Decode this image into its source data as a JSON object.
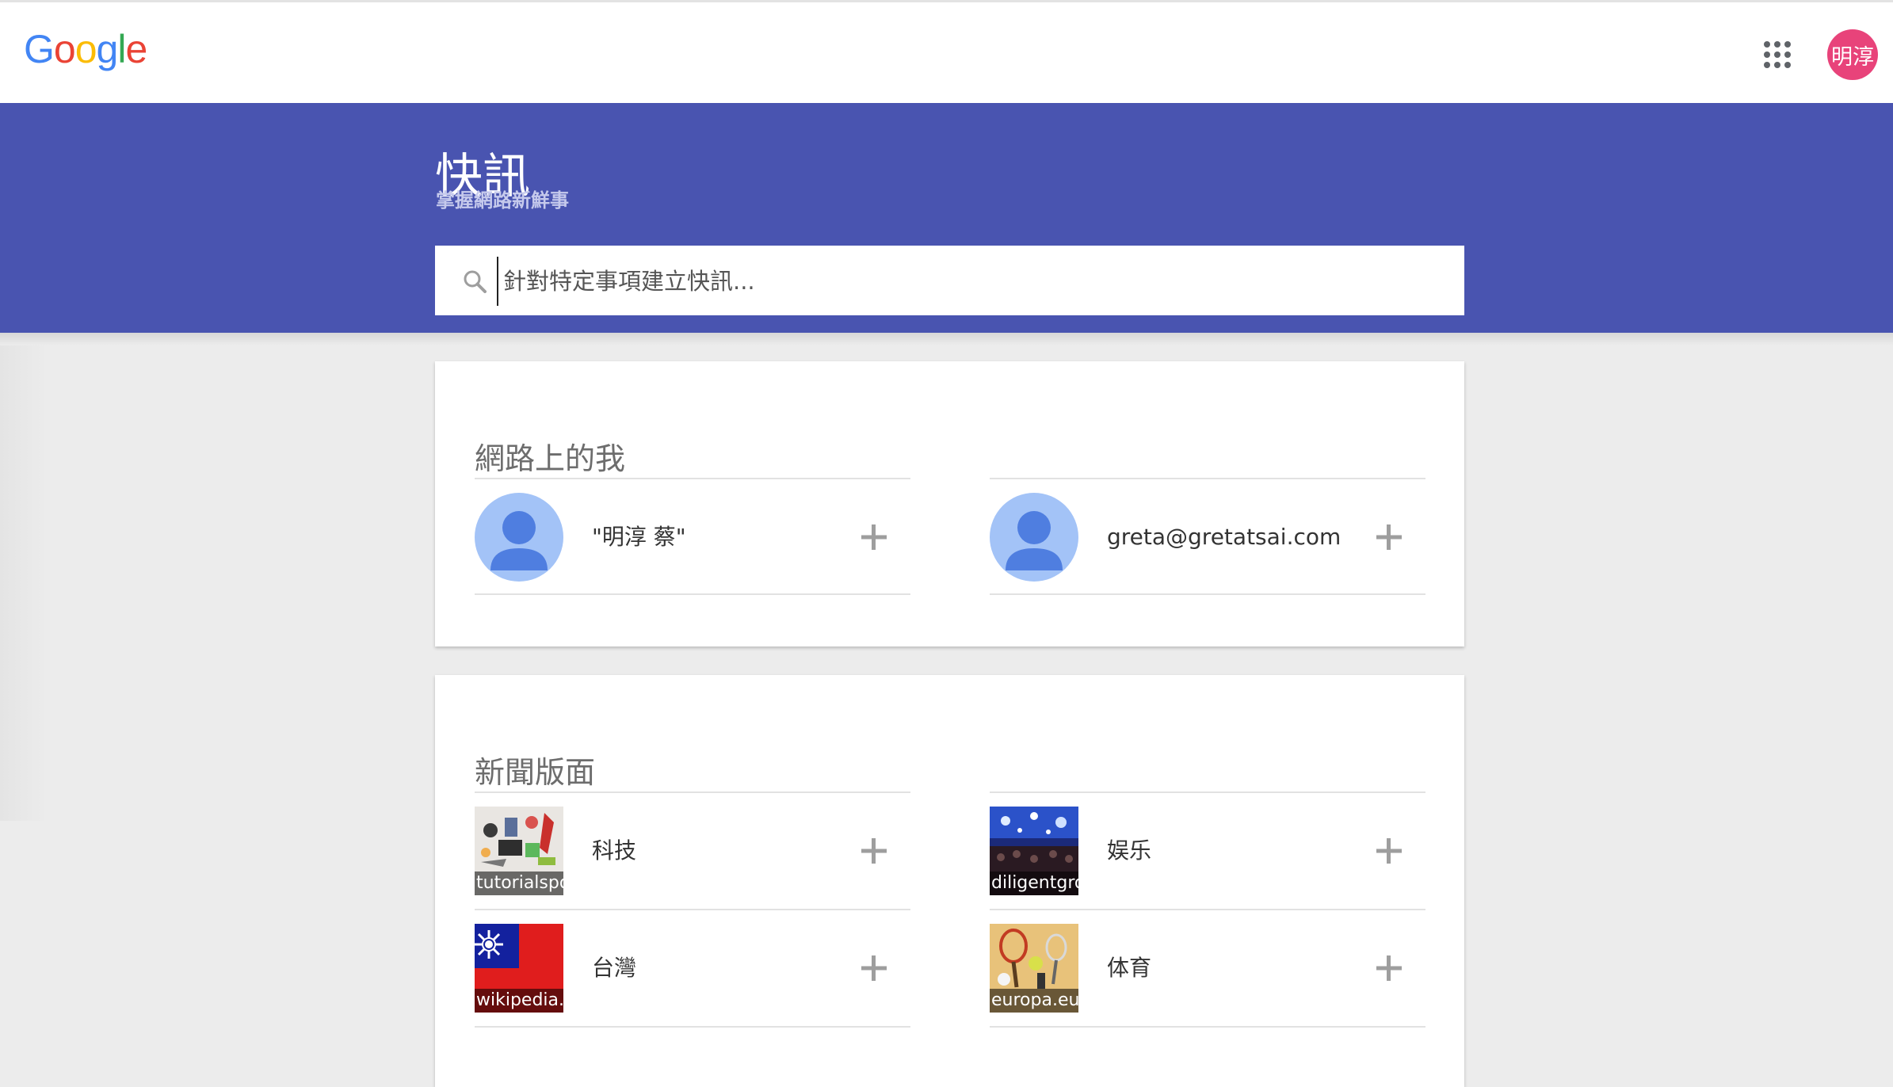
{
  "brand": {
    "logo_letters": [
      "G",
      "o",
      "o",
      "g",
      "l",
      "e"
    ],
    "logo_colors": [
      "#4285F4",
      "#EA4335",
      "#FBBC05",
      "#4285F4",
      "#34A853",
      "#EA4335"
    ]
  },
  "topbar": {
    "apps_icon": "grid-9-dots-icon",
    "account_initials": "明淳",
    "account_color": "#e8437a"
  },
  "header": {
    "title": "快訊",
    "subtitle": "掌握網路新鮮事",
    "banner_color": "#4954b0"
  },
  "search": {
    "icon": "search-icon",
    "placeholder": "針對特定事項建立快訊..."
  },
  "me_on_web": {
    "title": "網路上的我",
    "items": [
      {
        "label": "\"明淳 蔡\"",
        "icon": "person-avatar-icon",
        "action_icon": "plus-icon"
      },
      {
        "label": "greta@gretatsai.com",
        "icon": "person-avatar-icon",
        "action_icon": "plus-icon"
      }
    ]
  },
  "news_sections": {
    "title": "新聞版面",
    "items": [
      {
        "label": "科技",
        "source": "tutorialspo",
        "action_icon": "plus-icon"
      },
      {
        "label": "娱乐",
        "source": "diligentgro",
        "action_icon": "plus-icon"
      },
      {
        "label": "台灣",
        "source": "wikipedia.c",
        "action_icon": "plus-icon"
      },
      {
        "label": "体育",
        "source": "europa.eu",
        "action_icon": "plus-icon"
      }
    ]
  }
}
